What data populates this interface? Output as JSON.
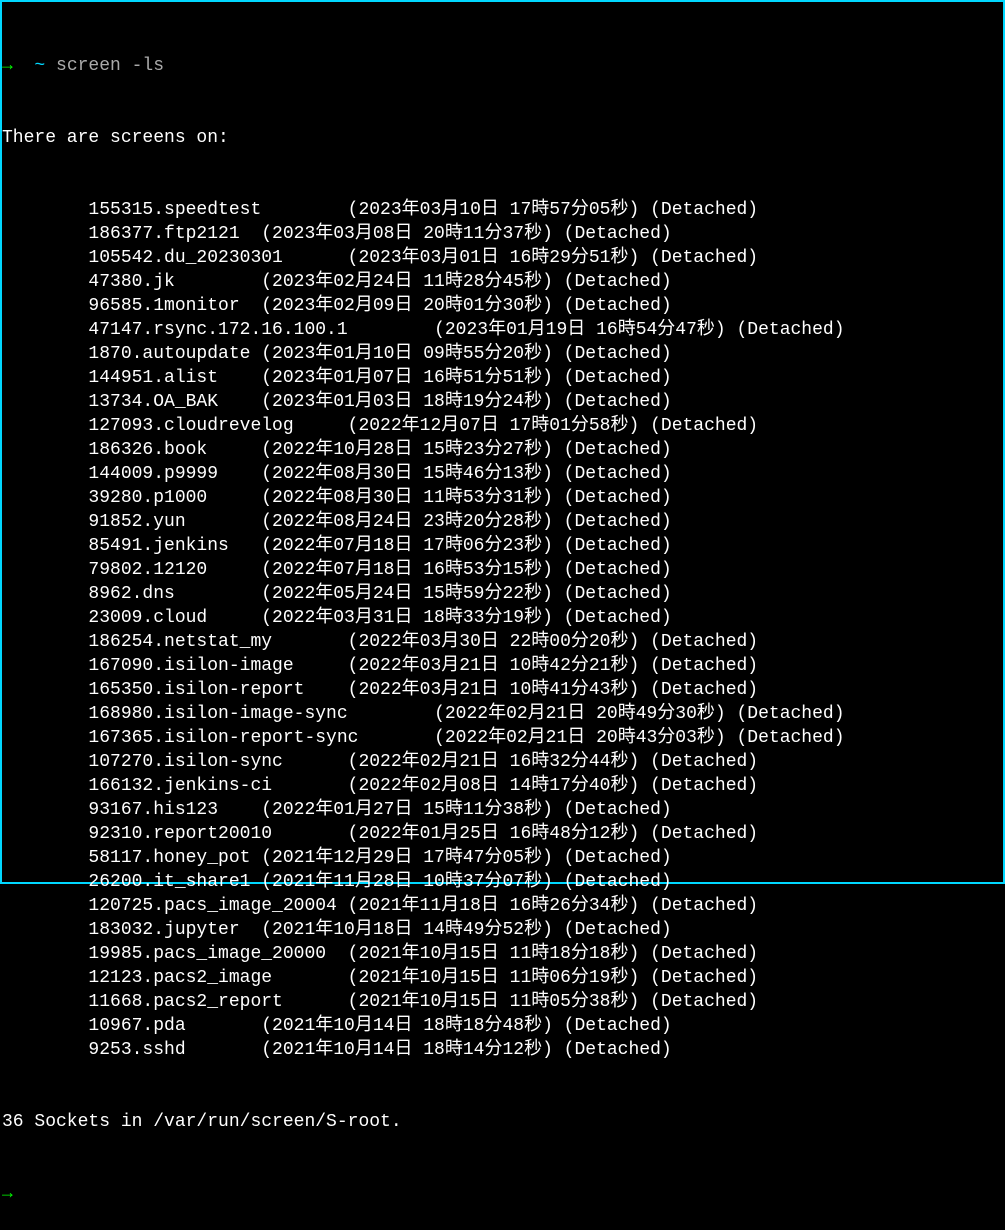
{
  "prompt": {
    "arrow": "→ ",
    "tilde": " ~ ",
    "command": "screen -ls"
  },
  "header": "There are screens on:",
  "tab": "        ",
  "sessions": [
    {
      "name": "155315.speedtest",
      "date": "(2023年03月10日 17時57分05秒)",
      "state": "(Detached)"
    },
    {
      "name": "186377.ftp2121",
      "date": "(2023年03月08日 20時11分37秒)",
      "state": "(Detached)"
    },
    {
      "name": "105542.du_20230301",
      "date": "(2023年03月01日 16時29分51秒)",
      "state": "(Detached)"
    },
    {
      "name": "47380.jk",
      "date": "(2023年02月24日 11時28分45秒)",
      "state": "(Detached)"
    },
    {
      "name": "96585.1monitor",
      "date": "(2023年02月09日 20時01分30秒)",
      "state": "(Detached)"
    },
    {
      "name": "47147.rsync.172.16.100.1",
      "date": "(2023年01月19日 16時54分47秒)",
      "state": "(Detached)"
    },
    {
      "name": "1870.autoupdate",
      "date": "(2023年01月10日 09時55分20秒)",
      "state": "(Detached)"
    },
    {
      "name": "144951.alist",
      "date": "(2023年01月07日 16時51分51秒)",
      "state": "(Detached)"
    },
    {
      "name": "13734.OA_BAK",
      "date": "(2023年01月03日 18時19分24秒)",
      "state": "(Detached)"
    },
    {
      "name": "127093.cloudrevelog",
      "date": "(2022年12月07日 17時01分58秒)",
      "state": "(Detached)"
    },
    {
      "name": "186326.book",
      "date": "(2022年10月28日 15時23分27秒)",
      "state": "(Detached)"
    },
    {
      "name": "144009.p9999",
      "date": "(2022年08月30日 15時46分13秒)",
      "state": "(Detached)"
    },
    {
      "name": "39280.p1000",
      "date": "(2022年08月30日 11時53分31秒)",
      "state": "(Detached)"
    },
    {
      "name": "91852.yun",
      "date": "(2022年08月24日 23時20分28秒)",
      "state": "(Detached)"
    },
    {
      "name": "85491.jenkins",
      "date": "(2022年07月18日 17時06分23秒)",
      "state": "(Detached)"
    },
    {
      "name": "79802.12120",
      "date": "(2022年07月18日 16時53分15秒)",
      "state": "(Detached)"
    },
    {
      "name": "8962.dns",
      "date": "(2022年05月24日 15時59分22秒)",
      "state": "(Detached)"
    },
    {
      "name": "23009.cloud",
      "date": "(2022年03月31日 18時33分19秒)",
      "state": "(Detached)"
    },
    {
      "name": "186254.netstat_my",
      "date": "(2022年03月30日 22時00分20秒)",
      "state": "(Detached)"
    },
    {
      "name": "167090.isilon-image",
      "date": "(2022年03月21日 10時42分21秒)",
      "state": "(Detached)"
    },
    {
      "name": "165350.isilon-report",
      "date": "(2022年03月21日 10時41分43秒)",
      "state": "(Detached)"
    },
    {
      "name": "168980.isilon-image-sync",
      "date": "(2022年02月21日 20時49分30秒)",
      "state": "(Detached)"
    },
    {
      "name": "167365.isilon-report-sync",
      "date": "(2022年02月21日 20時43分03秒)",
      "state": "(Detached)"
    },
    {
      "name": "107270.isilon-sync",
      "date": "(2022年02月21日 16時32分44秒)",
      "state": "(Detached)"
    },
    {
      "name": "166132.jenkins-ci",
      "date": "(2022年02月08日 14時17分40秒)",
      "state": "(Detached)"
    },
    {
      "name": "93167.his123",
      "date": "(2022年01月27日 15時11分38秒)",
      "state": "(Detached)"
    },
    {
      "name": "92310.report20010",
      "date": "(2022年01月25日 16時48分12秒)",
      "state": "(Detached)"
    },
    {
      "name": "58117.honey_pot",
      "date": "(2021年12月29日 17時47分05秒)",
      "state": "(Detached)"
    },
    {
      "name": "26200.it_share1",
      "date": "(2021年11月28日 10時37分07秒)",
      "state": "(Detached)"
    },
    {
      "name": "120725.pacs_image_20004",
      "date": "(2021年11月18日 16時26分34秒)",
      "state": "(Detached)"
    },
    {
      "name": "183032.jupyter",
      "date": "(2021年10月18日 14時49分52秒)",
      "state": "(Detached)"
    },
    {
      "name": "19985.pacs_image_20000",
      "date": "(2021年10月15日 11時18分18秒)",
      "state": "(Detached)"
    },
    {
      "name": "12123.pacs2_image",
      "date": "(2021年10月15日 11時06分19秒)",
      "state": "(Detached)"
    },
    {
      "name": "11668.pacs2_report",
      "date": "(2021年10月15日 11時05分38秒)",
      "state": "(Detached)"
    },
    {
      "name": "10967.pda",
      "date": "(2021年10月14日 18時18分48秒)",
      "state": "(Detached)"
    },
    {
      "name": "9253.sshd",
      "date": "(2021年10月14日 18時14分12秒)",
      "state": "(Detached)"
    }
  ],
  "footer": "36 Sockets in /var/run/screen/S-root.",
  "next_arrow": "→"
}
